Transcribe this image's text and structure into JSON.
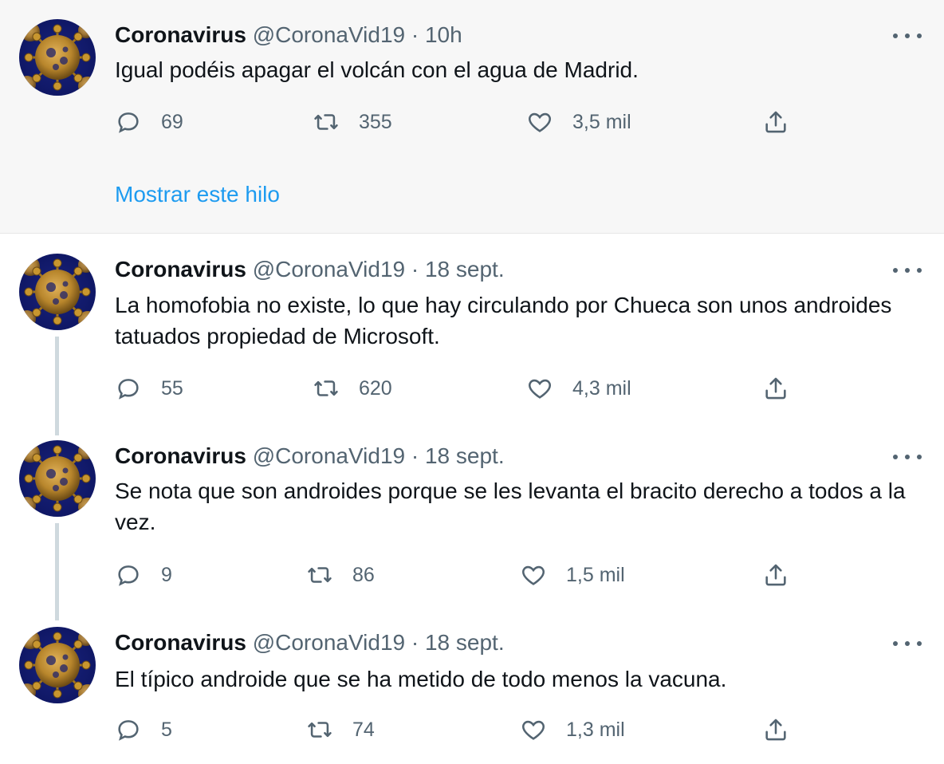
{
  "tweets": [
    {
      "name": "Coronavirus",
      "handle": "@CoronaVid19",
      "sep": "·",
      "time": "10h",
      "text": "Igual podéis apagar el volcán con el agua de Madrid.",
      "replies": "69",
      "retweets": "355",
      "likes": "3,5 mil",
      "show_thread": "Mostrar este hilo"
    },
    {
      "name": "Coronavirus",
      "handle": "@CoronaVid19",
      "sep": "·",
      "time": "18 sept.",
      "text": "La homofobia no existe, lo que hay circulando por Chueca son unos androides tatuados propiedad de Microsoft.",
      "replies": "55",
      "retweets": "620",
      "likes": "4,3 mil"
    },
    {
      "name": "Coronavirus",
      "handle": "@CoronaVid19",
      "sep": "·",
      "time": "18 sept.",
      "text": "Se nota que son androides porque se les levanta el bracito derecho a todos a la vez.",
      "replies": "9",
      "retweets": "86",
      "likes": "1,5 mil"
    },
    {
      "name": "Coronavirus",
      "handle": "@CoronaVid19",
      "sep": "·",
      "time": "18 sept.",
      "text": "El típico androide que se ha metido de todo menos la vacuna.",
      "replies": "5",
      "retweets": "74",
      "likes": "1,3 mil"
    }
  ],
  "icons": {
    "reply": "reply-icon",
    "retweet": "retweet-icon",
    "like": "heart-icon",
    "share": "share-icon",
    "more": "more-icon"
  },
  "colors": {
    "link": "#1d9bf0",
    "secondary_text": "#536471",
    "highlight_bg": "#f7f7f7",
    "thread_line": "#cfd9de"
  }
}
